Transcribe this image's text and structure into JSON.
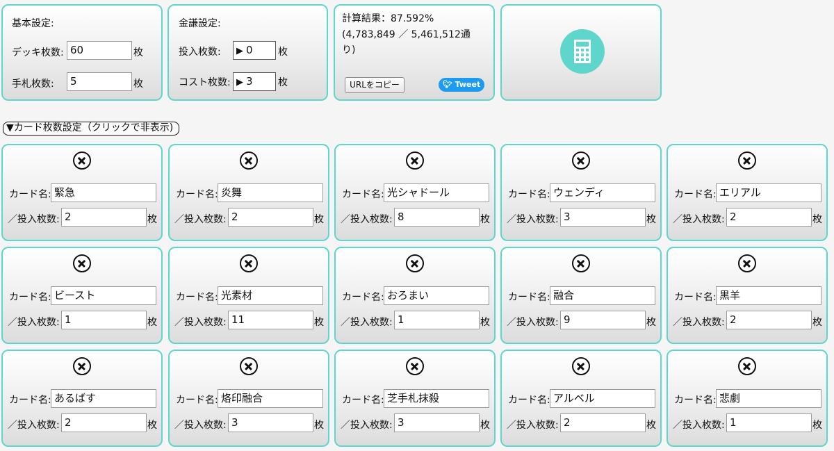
{
  "basic": {
    "title": "基本設定:",
    "deck_label": "デッキ枚数:",
    "deck_value": "60",
    "deck_unit": "枚",
    "hand_label": "手札枚数:",
    "hand_value": "5",
    "hand_unit": "枚"
  },
  "cost": {
    "title": "金謙設定:",
    "put_label": "投入枚数:",
    "put_value": "0",
    "put_unit": "枚",
    "cost_label": "コスト枚数:",
    "cost_value": "3",
    "cost_unit": "枚"
  },
  "result": {
    "line1": "計算結果：87.592%",
    "line2": "(4,783,849 ／ 5,461,512通",
    "line3": "り)",
    "copy_button": "URLをコピー",
    "tweet_button": "Tweet"
  },
  "calc_icon": "calculator-icon",
  "accent_color": "#5fd6cc",
  "toggle_label": "▼カード枚数設定（クリックで非表示)",
  "card_name_label": "カード名:",
  "card_count_label": "／投入枚数:",
  "card_unit": "枚",
  "cards": [
    {
      "name": "緊急",
      "count": "2"
    },
    {
      "name": "炎舞",
      "count": "2"
    },
    {
      "name": "光シャドール",
      "count": "8"
    },
    {
      "name": "ウェンディ",
      "count": "3"
    },
    {
      "name": "エリアル",
      "count": "2"
    },
    {
      "name": "ビースト",
      "count": "1"
    },
    {
      "name": "光素材",
      "count": "11"
    },
    {
      "name": "おろまい",
      "count": "1"
    },
    {
      "name": "融合",
      "count": "9"
    },
    {
      "name": "黒羊",
      "count": "2"
    },
    {
      "name": "あるばす",
      "count": "2"
    },
    {
      "name": "烙印融合",
      "count": "3"
    },
    {
      "name": "芝手札抹殺",
      "count": "3"
    },
    {
      "name": "アルベル",
      "count": "2"
    },
    {
      "name": "悲劇",
      "count": "1"
    }
  ]
}
